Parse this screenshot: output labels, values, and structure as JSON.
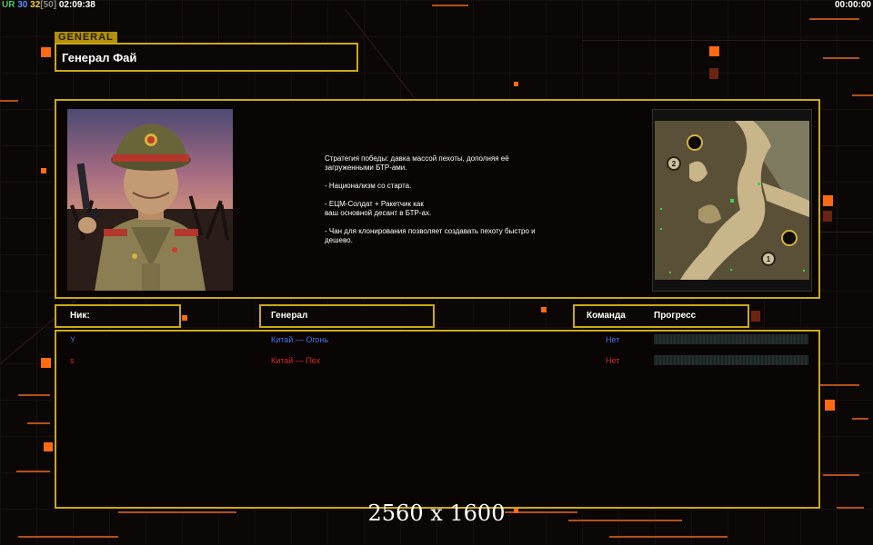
{
  "hud": {
    "ur": "UR",
    "players_count": "30",
    "players_ready": "32",
    "players_max": "[50]",
    "clock": "02:09:38",
    "timer": "00:00:00"
  },
  "general": {
    "tag": "GENERAL",
    "name": "Генерал Фай",
    "description": [
      "Стратегия победы: давка массой пехоты, дополняя её\n загруженными БТР-ами.",
      "- Национализм со старта.",
      "- ЕЦМ-Солдат + Ракетчик как\nваш основной десант в БТР-ах.",
      "- Чан для клонирования позволяет создавать пехоту быстро и\n дешево."
    ]
  },
  "map": {
    "start_markers": [
      "2",
      "1"
    ]
  },
  "columns": {
    "nick": "Ник:",
    "general": "Генерал",
    "team": "Команда",
    "progress": "Прогресс"
  },
  "players": [
    {
      "nick": "Y",
      "general": "Китай — Огонь",
      "team": "Нет",
      "color": "#4f6fe6"
    },
    {
      "nick": "s",
      "general": "Китай — Пех",
      "team": "Нет",
      "color": "#d42a2a"
    }
  ],
  "resolution_label": "2560 x 1600",
  "colors": {
    "frame": "#c9a915",
    "accent": "#ff6a12",
    "background": "#0c0707"
  }
}
